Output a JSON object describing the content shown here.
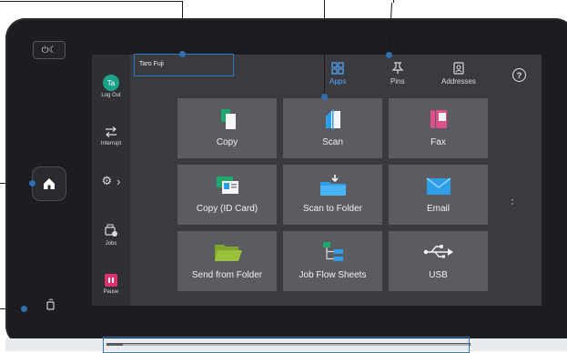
{
  "user": {
    "name": "Taro Fuji"
  },
  "sidebar": {
    "avatar_initials": "Ta",
    "logout_label": "Log Out",
    "interrupt_label": "Interrupt",
    "jobs_label": "Jobs",
    "pause_label": "Pause"
  },
  "topnav": [
    {
      "label": "Apps",
      "icon": "apps-grid-icon",
      "active": true
    },
    {
      "label": "Pins",
      "icon": "pin-icon",
      "active": false
    },
    {
      "label": "Addresses",
      "icon": "address-book-icon",
      "active": false
    }
  ],
  "help_label": "?",
  "tiles": [
    {
      "label": "Copy",
      "icon": "copy-icon"
    },
    {
      "label": "Scan",
      "icon": "scan-icon"
    },
    {
      "label": "Fax",
      "icon": "fax-icon"
    },
    {
      "label": "Copy (ID Card)",
      "icon": "id-card-copy-icon"
    },
    {
      "label": "Scan to Folder",
      "icon": "scan-to-folder-icon"
    },
    {
      "label": "Email",
      "icon": "email-icon"
    },
    {
      "label": "Send from Folder",
      "icon": "send-from-folder-icon"
    },
    {
      "label": "Job Flow Sheets",
      "icon": "job-flow-icon"
    },
    {
      "label": "USB",
      "icon": "usb-icon"
    }
  ],
  "colors": {
    "accent_blue": "#55a7ff",
    "avatar_green": "#1aa38a",
    "pause_pink": "#e0306b",
    "copy_green": "#1ea86b",
    "scan_blue": "#2f9ee8",
    "fax_pink": "#e0508a",
    "folder_green": "#9ac13b"
  }
}
